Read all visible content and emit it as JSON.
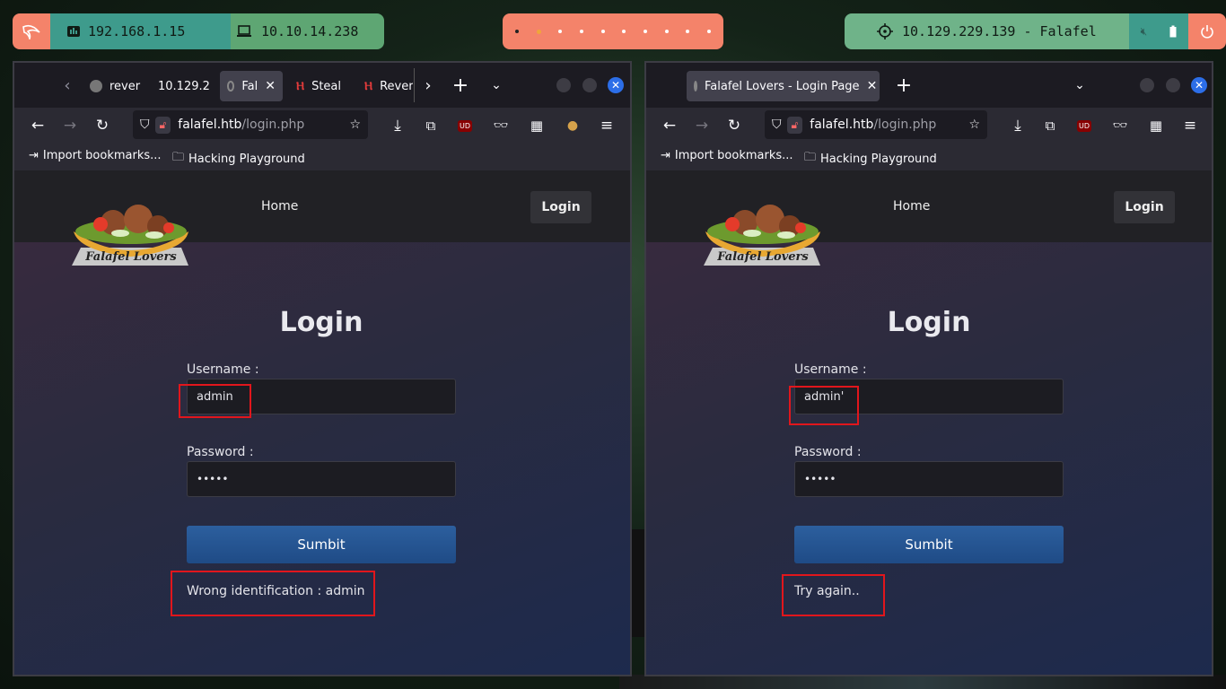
{
  "panel": {
    "ip_local": "192.168.1.15",
    "ip_vpn": "10.10.14.238",
    "target": "10.129.229.139 - Falafel"
  },
  "left_window": {
    "tabs": [
      "rever",
      "10.129.2",
      "Fal",
      "Steal",
      "Rever"
    ],
    "url_host": "falafel.htb",
    "url_path": "/login.php",
    "bookmarks": [
      "Import bookmarks...",
      "Hacking Playground"
    ],
    "nav_home": "Home",
    "nav_login": "Login",
    "heading": "Login",
    "username_label": "Username :",
    "username_value": "admin",
    "password_label": "Password :",
    "password_value": "•••••",
    "submit_label": "Sumbit",
    "message": "Wrong identification : admin"
  },
  "right_window": {
    "tabs": [
      "Falafel Lovers - Login Page"
    ],
    "url_host": "falafel.htb",
    "url_path": "/login.php",
    "bookmarks": [
      "Import bookmarks...",
      "Hacking Playground"
    ],
    "nav_home": "Home",
    "nav_login": "Login",
    "heading": "Login",
    "username_label": "Username :",
    "username_value": "admin'",
    "password_label": "Password :",
    "password_value": "•••••",
    "submit_label": "Sumbit",
    "message": "Try again.."
  },
  "logo_text": "Falafel Lovers",
  "colors": {
    "highlight": "#e1161c",
    "submit": "#2c5f9e",
    "panel_orange": "#f4836a"
  }
}
